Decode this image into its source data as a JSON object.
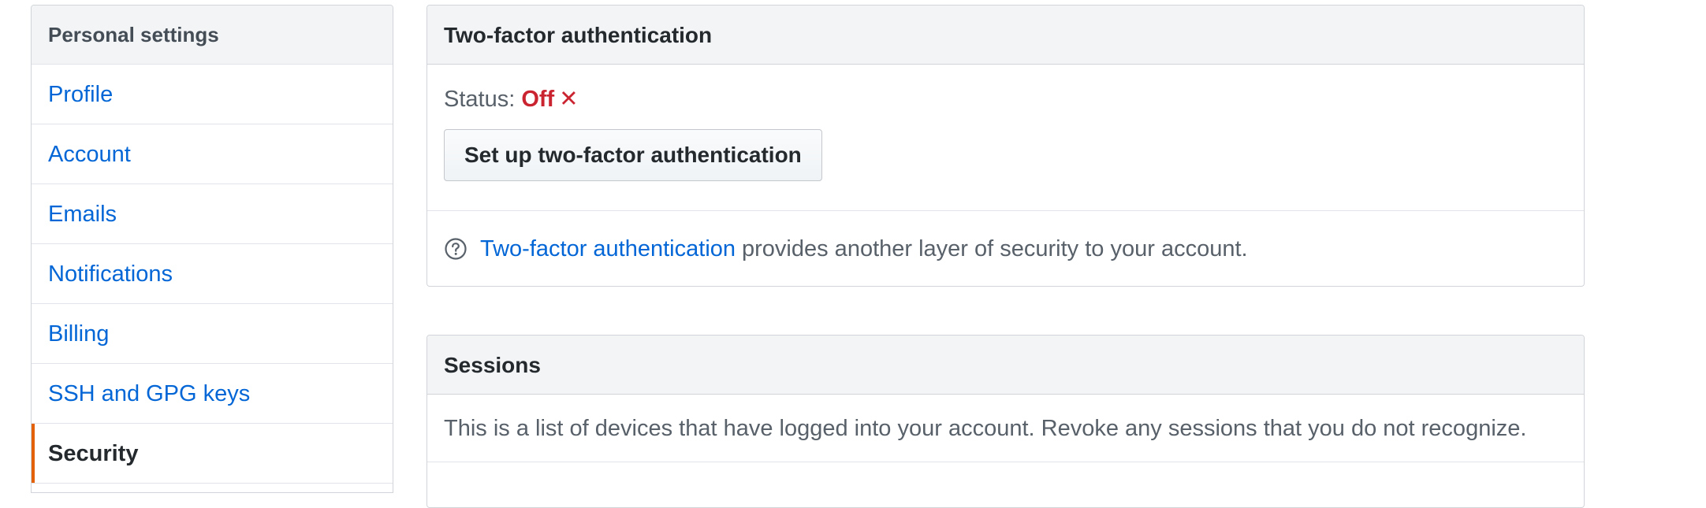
{
  "sidebar": {
    "title": "Personal settings",
    "items": [
      {
        "label": "Profile"
      },
      {
        "label": "Account"
      },
      {
        "label": "Emails"
      },
      {
        "label": "Notifications"
      },
      {
        "label": "Billing"
      },
      {
        "label": "SSH and GPG keys"
      },
      {
        "label": "Security",
        "selected": true
      }
    ],
    "accent_color": "#e36209",
    "link_color": "#0366d6"
  },
  "two_factor": {
    "title": "Two-factor authentication",
    "status_label": "Status:",
    "status_value": "Off",
    "status_icon": "x-icon",
    "status_glyph": "✕",
    "status_color": "#cb2431",
    "setup_button_label": "Set up two-factor authentication",
    "help_icon": "question-circle-icon",
    "help_link_text": "Two-factor authentication",
    "help_text": "provides another layer of security to your account."
  },
  "sessions": {
    "title": "Sessions",
    "description": "This is a list of devices that have logged into your account. Revoke any sessions that you do not recognize."
  }
}
